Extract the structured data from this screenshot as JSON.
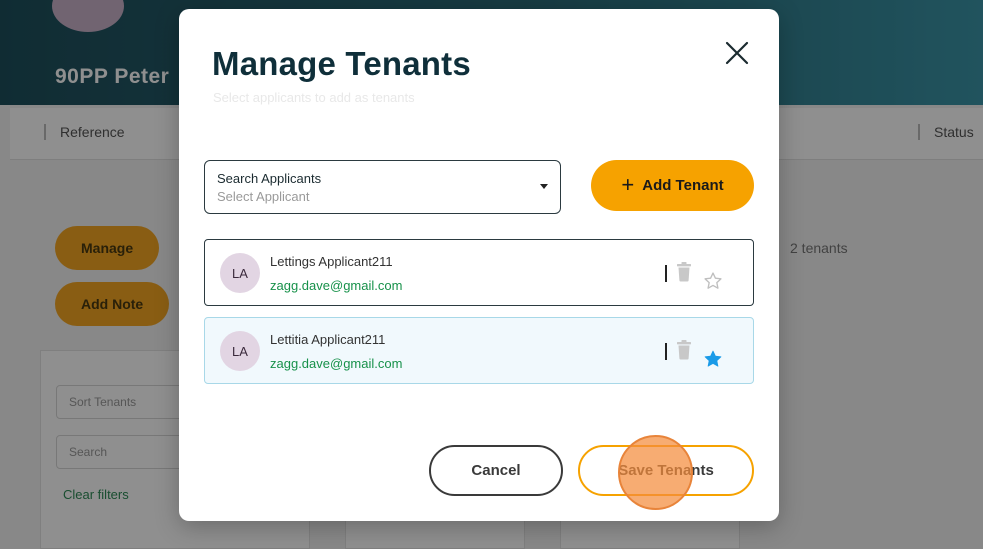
{
  "background": {
    "page_title": "90PP Peter",
    "tabs": [
      "Reference",
      "Status"
    ],
    "buttons": [
      "Manage",
      "Add Note"
    ],
    "tenants_count_text": "2 tenants",
    "filter_field_1": "Sort Tenants",
    "filter_field_2": "Search",
    "filter_link": "Clear filters"
  },
  "modal": {
    "title": "Manage Tenants",
    "subtitle": "Select applicants to add as tenants",
    "close_icon": "close-icon",
    "search": {
      "label": "Search Applicants",
      "placeholder": "Select Applicant",
      "caret_icon": "caret-down-icon"
    },
    "add_button": {
      "icon": "plus-icon",
      "label": "Add Tenant"
    },
    "tenants": [
      {
        "initials": "LA",
        "name": "Lettings Applicant211",
        "email": "zagg.dave@gmail.com",
        "lead": false
      },
      {
        "initials": "LA",
        "name": "Lettitia Applicant211",
        "email": "zagg.dave@gmail.com",
        "lead": true
      }
    ],
    "cancel_label": "Cancel",
    "save_label": "Save Tenants"
  },
  "colors": {
    "accent": "#f6a200",
    "email": "#17914a",
    "star_active": "#1a9be8",
    "title": "#0f2f3a"
  }
}
